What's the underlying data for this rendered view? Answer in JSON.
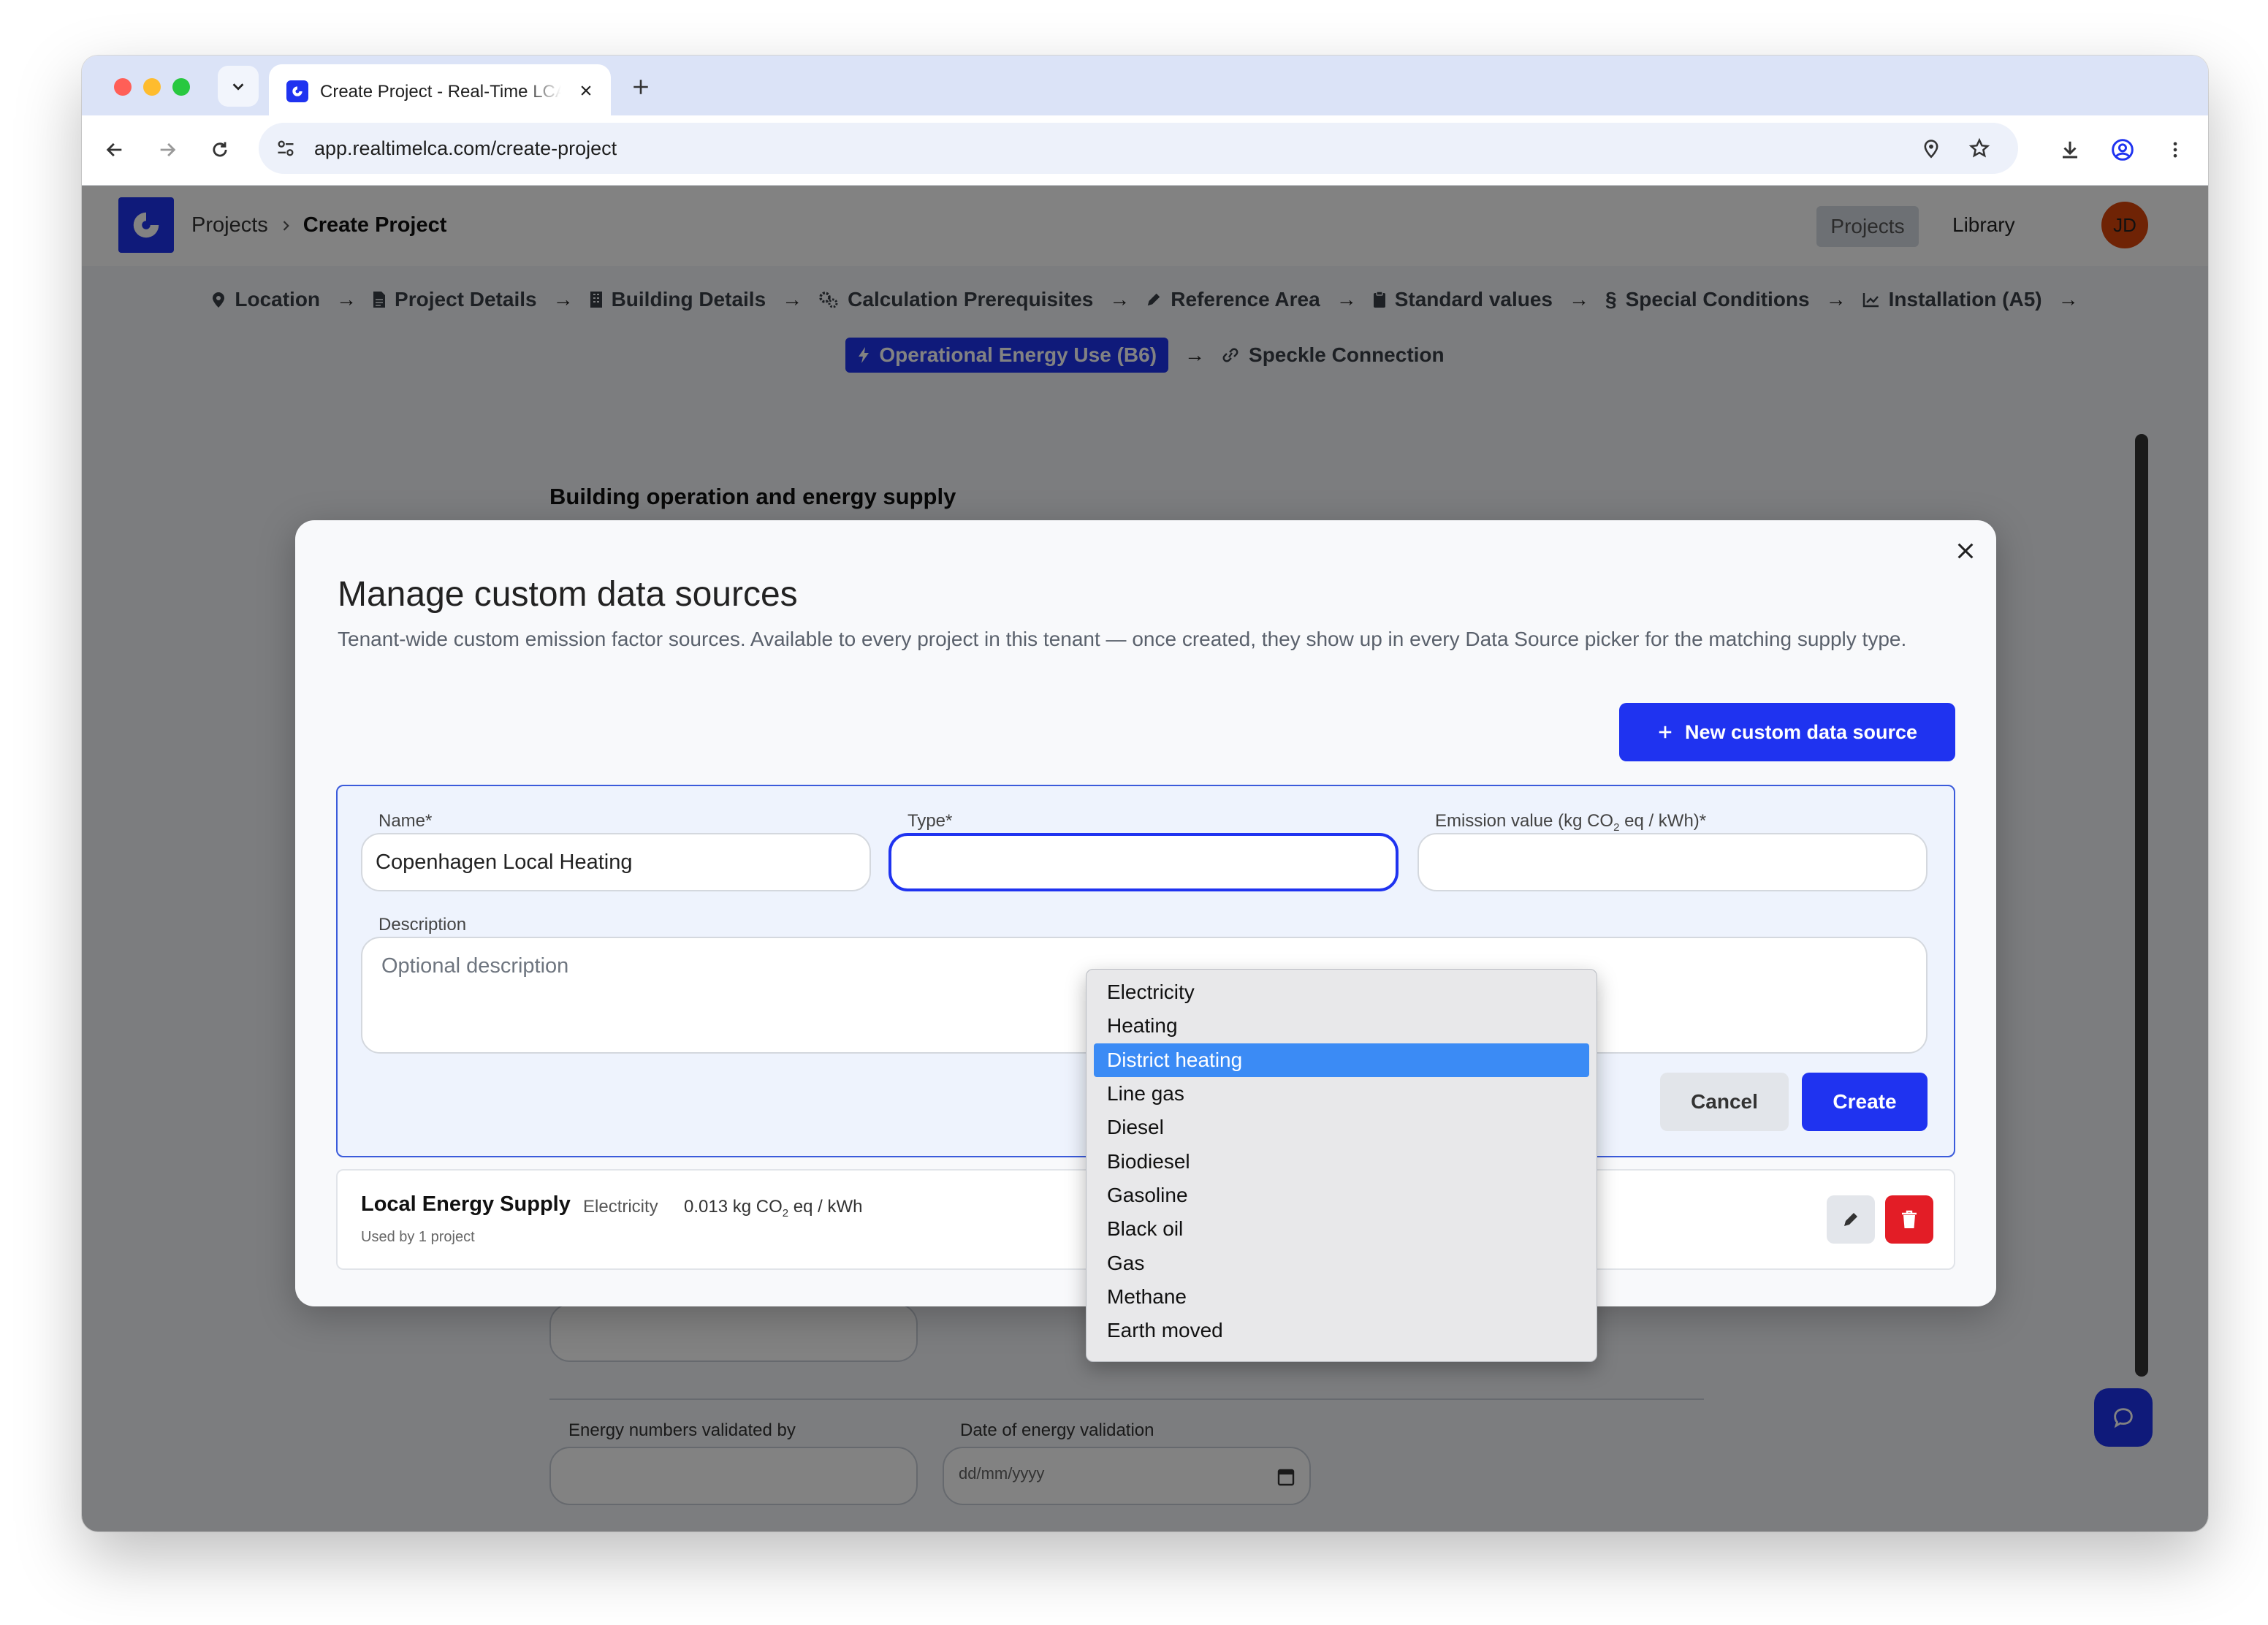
{
  "browser": {
    "tab_title": "Create Project - Real-Time LCA",
    "url": "app.realtimelca.com/create-project"
  },
  "header": {
    "breadcrumb_root": "Projects",
    "breadcrumb_current": "Create Project",
    "nav_projects": "Projects",
    "nav_library": "Library",
    "avatar_initials": "JD"
  },
  "steps": {
    "row1": [
      "Location",
      "Project Details",
      "Building Details",
      "Calculation Prerequisites",
      "Reference Area",
      "Standard values",
      "Special Conditions",
      "Installation (A5)"
    ],
    "active": "Operational Energy Use (B6)",
    "last": "Speckle Connection"
  },
  "page": {
    "section_title": "Building operation and energy supply",
    "validated_by_label": "Energy numbers validated by",
    "validation_date_label": "Date of energy validation",
    "date_placeholder": "dd/mm/yyyy"
  },
  "modal": {
    "title": "Manage custom data sources",
    "description": "Tenant-wide custom emission factor sources. Available to every project in this tenant — once created, they show up in every Data Source picker for the matching supply type.",
    "new_button": "New custom data source",
    "form": {
      "name_label": "Name*",
      "name_value": "Copenhagen Local Heating",
      "type_label": "Type*",
      "emission_label_pre": "Emission value (kg CO",
      "emission_label_sub": "2",
      "emission_label_post": " eq / kWh)*",
      "emission_value": "",
      "description_label": "Description",
      "description_placeholder": "Optional description",
      "cancel": "Cancel",
      "create": "Create"
    },
    "type_options": [
      "Electricity",
      "Heating",
      "District heating",
      "Line gas",
      "Diesel",
      "Biodiesel",
      "Gasoline",
      "Black oil",
      "Gas",
      "Methane",
      "Earth moved"
    ],
    "type_highlighted": "District heating",
    "sources": [
      {
        "name": "Local Energy Supply",
        "type": "Electricity",
        "value_pre": "0.013 kg CO",
        "value_sub": "2",
        "value_post": " eq / kWh",
        "usage": "Used by 1 project"
      }
    ]
  },
  "colors": {
    "brand": "#1f33f0",
    "highlight": "#3b8bf5",
    "danger": "#e31d26",
    "avatar": "#d9450b"
  },
  "icons": [
    "chevron-down-icon",
    "close-icon",
    "plus-icon",
    "back-icon",
    "forward-icon",
    "reload-icon",
    "site-info-icon",
    "location-pin-icon",
    "star-icon",
    "download-icon",
    "profile-icon",
    "more-vert-icon",
    "pin-icon",
    "document-icon",
    "building-icon",
    "cogs-icon",
    "pencil-icon",
    "clipboard-icon",
    "section-icon",
    "chart-icon",
    "bolt-icon",
    "link-icon",
    "calendar-icon",
    "chat-icon",
    "trash-icon"
  ]
}
